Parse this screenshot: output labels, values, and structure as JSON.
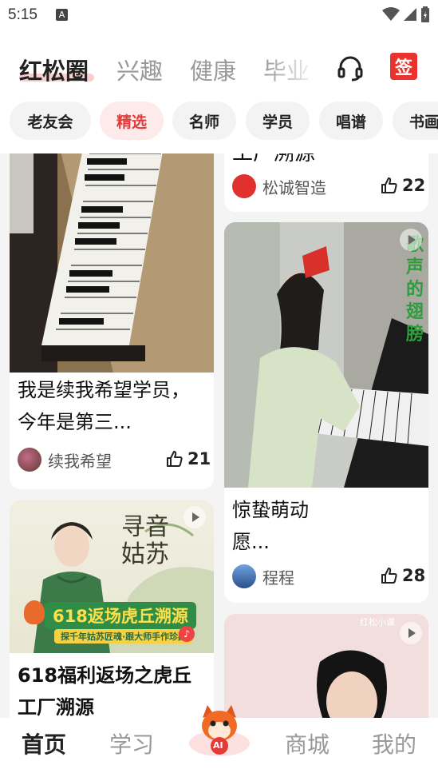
{
  "status": {
    "time": "5:15",
    "a_badge": "A"
  },
  "header": {
    "tabs": [
      {
        "label": "红松圈",
        "active": true
      },
      {
        "label": "兴趣",
        "active": false
      },
      {
        "label": "健康",
        "active": false
      },
      {
        "label": "毕业",
        "active": false
      }
    ],
    "sign_label": "签",
    "icons": {
      "support": "headset-icon",
      "sign": "sign-in-icon"
    }
  },
  "chips": [
    {
      "label": "老友会",
      "active": false
    },
    {
      "label": "精选",
      "active": true
    },
    {
      "label": "名师",
      "active": false
    },
    {
      "label": "学员",
      "active": false
    },
    {
      "label": "唱谱",
      "active": false
    },
    {
      "label": "书画",
      "active": false
    }
  ],
  "feed": {
    "left": [
      {
        "title": "我是续我希望学员，今年是第三...",
        "author": "续我希望",
        "likes": "21",
        "image": "piano-keys"
      },
      {
        "title": "618福利返场之虎丘工厂溯源",
        "author": "",
        "likes": "",
        "image": "promo-banner",
        "banner": {
          "calligraphy": "寻音姑苏",
          "headline": "618返场虎丘溯源",
          "sub": "探千年姑苏匠魂·跟大师手作珍藏"
        }
      }
    ],
    "right": [
      {
        "title": "工厂溯源",
        "author": "松诚智造",
        "likes": "22",
        "image": ""
      },
      {
        "title": "惊蛰萌动愿...",
        "title_line1": "惊蛰萌动",
        "title_line2": "愿...",
        "author": "程程",
        "likes": "28",
        "image": "piano-player",
        "overlay_text": "歌声的翅膀"
      },
      {
        "title": "",
        "author": "",
        "likes": "",
        "image": "portrait",
        "watermark": "红松小课"
      }
    ]
  },
  "bottom_nav": {
    "items": [
      {
        "label": "首页",
        "active": true
      },
      {
        "label": "学习",
        "active": false
      },
      {
        "label": "AI",
        "active": false
      },
      {
        "label": "商城",
        "active": false
      },
      {
        "label": "我的",
        "active": false
      }
    ]
  },
  "colors": {
    "accent": "#e23b3b",
    "chip_active_bg": "#fdeaea",
    "tab_underline": "#f5c2c2"
  }
}
